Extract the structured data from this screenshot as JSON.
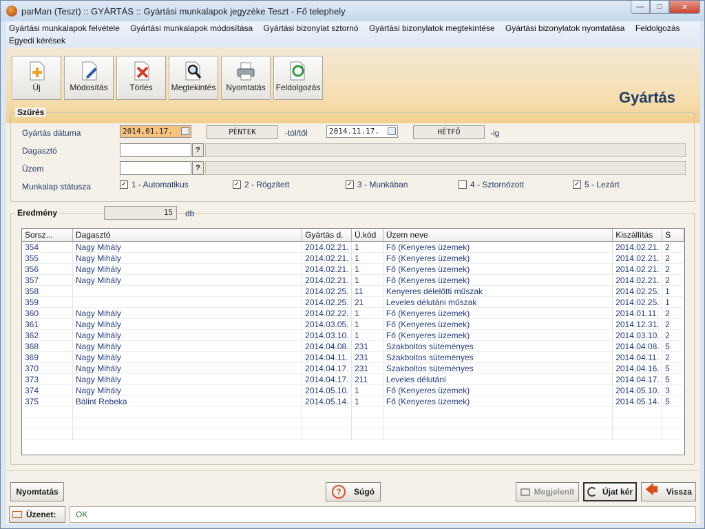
{
  "window": {
    "title": "parMan (Teszt) :: GYÁRTÁS :: Gyártási munkalapok jegyzéke    Teszt - Fő telephely"
  },
  "menu": [
    "Gyártási munkalapok felvétele",
    "Gyártási munkalapok módosítása",
    "Gyártási bizonylat sztornó",
    "Gyártási bizonylatok megtekintése",
    "Gyártási bizonylatok nyomtatása",
    "Feldolgozás",
    "Egyedi kérések"
  ],
  "toolbar": {
    "new": "Új",
    "edit": "Módosítás",
    "delete": "Törlés",
    "view": "Megtekintés",
    "print": "Nyomtatás",
    "process": "Feldolgozás",
    "section_title": "Gyártás"
  },
  "filter": {
    "legend": "Szűrés",
    "date_label": "Gyártás dátuma",
    "date_from": "2014.01.17.",
    "day_from": "PÉNTEK",
    "from_suffix": "-tól/től",
    "date_to": "2014.11.17.",
    "day_to": "HÉTFŐ",
    "to_suffix": "-ig",
    "dough_label": "Dagasztó",
    "plant_label": "Üzem",
    "status_label": "Munkalap státusza",
    "q": "?",
    "statuses": [
      {
        "label": "1 - Automatikus",
        "checked": true
      },
      {
        "label": "2 - Rögzített",
        "checked": true
      },
      {
        "label": "3 - Munkában",
        "checked": true
      },
      {
        "label": "4 - Sztornózott",
        "checked": false
      },
      {
        "label": "5 - Lezárt",
        "checked": true
      }
    ]
  },
  "result": {
    "legend": "Eredmény",
    "count": "15",
    "unit": "db",
    "columns": [
      "Sorsz...",
      "Dagasztó",
      "Gyártás d.",
      "Ü.kód",
      "Üzem neve",
      "Kiszállítás",
      "S"
    ],
    "rows": [
      [
        "354",
        "Nagy Mihály",
        "2014.02.21.",
        "1",
        "Fő (Kenyeres üzemek)",
        "2014.02.21.",
        "2"
      ],
      [
        "355",
        "Nagy Mihály",
        "2014.02.21.",
        "1",
        "Fő (Kenyeres üzemek)",
        "2014.02.21.",
        "2"
      ],
      [
        "356",
        "Nagy Mihály",
        "2014.02.21.",
        "1",
        "Fő (Kenyeres üzemek)",
        "2014.02.21.",
        "2"
      ],
      [
        "357",
        "Nagy Mihály",
        "2014.02.21.",
        "1",
        "Fő (Kenyeres üzemek)",
        "2014.02.21.",
        "2"
      ],
      [
        "358",
        "",
        "2014.02.25.",
        "11",
        "Kenyeres délelőtti műszak",
        "2014.02.25.",
        "1"
      ],
      [
        "359",
        "",
        "2014.02.25.",
        "21",
        "Leveles délutáni műszak",
        "2014.02.25.",
        "1"
      ],
      [
        "360",
        "Nagy Mihály",
        "2014.02.22.",
        "1",
        "Fő (Kenyeres üzemek)",
        "2014.01.11.",
        "2"
      ],
      [
        "361",
        "Nagy Mihály",
        "2014.03.05.",
        "1",
        "Fő (Kenyeres üzemek)",
        "2014.12.31.",
        "2"
      ],
      [
        "362",
        "Nagy Mihály",
        "2014.03.10.",
        "1",
        "Fő (Kenyeres üzemek)",
        "2014.03.10.",
        "2"
      ],
      [
        "368",
        "Nagy Mihály",
        "2014.04.08.",
        "231",
        "Szakboltos süteményes",
        "2014.04.08.",
        "5"
      ],
      [
        "369",
        "Nagy Mihály",
        "2014.04.11.",
        "231",
        "Szakboltos süteményes",
        "2014.04.11.",
        "2"
      ],
      [
        "370",
        "Nagy Mihály",
        "2014.04.17.",
        "231",
        "Szakboltos süteményes",
        "2014.04.16.",
        "5"
      ],
      [
        "373",
        "Nagy Mihály",
        "2014.04.17.",
        "211",
        "Leveles délutáni",
        "2014.04.17.",
        "5"
      ],
      [
        "374",
        "Nagy Mihály",
        "2014.05.10.",
        "1",
        "Fő (Kenyeres üzemek)",
        "2014.05.10.",
        "3"
      ],
      [
        "375",
        "Bálint Rebeka",
        "2014.05.14.",
        "1",
        "Fő (Kenyeres üzemek)",
        "2014.05.14.",
        "5"
      ]
    ]
  },
  "bottom": {
    "print": "Nyomtatás",
    "help": "Súgó",
    "display": "Megjelenít",
    "new_request": "Újat kér",
    "back": "Vissza",
    "message_label": "Üzenet:",
    "message": "OK"
  }
}
